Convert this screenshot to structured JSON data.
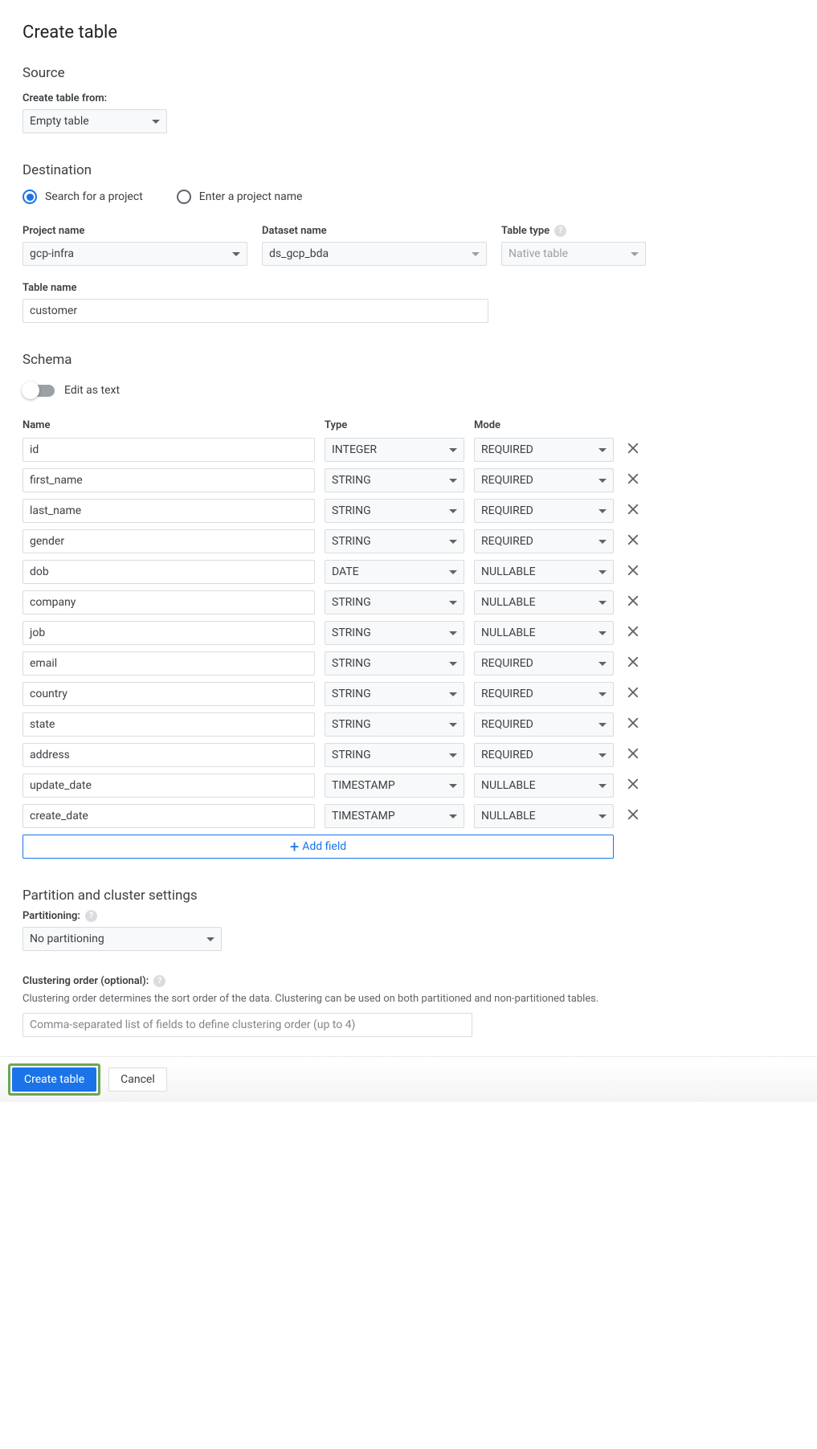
{
  "page_title": "Create table",
  "source": {
    "section_title": "Source",
    "create_from_label": "Create table from:",
    "create_from_value": "Empty table"
  },
  "destination": {
    "section_title": "Destination",
    "radio_search": "Search for a project",
    "radio_enter": "Enter a project name",
    "project_label": "Project name",
    "project_value": "gcp-infra",
    "dataset_label": "Dataset name",
    "dataset_value": "ds_gcp_bda",
    "tabletype_label": "Table type",
    "tabletype_value": "Native table",
    "tablename_label": "Table name",
    "tablename_value": "customer"
  },
  "schema": {
    "section_title": "Schema",
    "edit_as_text": "Edit as text",
    "header_name": "Name",
    "header_type": "Type",
    "header_mode": "Mode",
    "add_field": "Add field",
    "rows": [
      {
        "name": "id",
        "type": "INTEGER",
        "mode": "REQUIRED"
      },
      {
        "name": "first_name",
        "type": "STRING",
        "mode": "REQUIRED"
      },
      {
        "name": "last_name",
        "type": "STRING",
        "mode": "REQUIRED"
      },
      {
        "name": "gender",
        "type": "STRING",
        "mode": "REQUIRED"
      },
      {
        "name": "dob",
        "type": "DATE",
        "mode": "NULLABLE"
      },
      {
        "name": "company",
        "type": "STRING",
        "mode": "NULLABLE"
      },
      {
        "name": "job",
        "type": "STRING",
        "mode": "NULLABLE"
      },
      {
        "name": "email",
        "type": "STRING",
        "mode": "REQUIRED"
      },
      {
        "name": "country",
        "type": "STRING",
        "mode": "REQUIRED"
      },
      {
        "name": "state",
        "type": "STRING",
        "mode": "REQUIRED"
      },
      {
        "name": "address",
        "type": "STRING",
        "mode": "REQUIRED"
      },
      {
        "name": "update_date",
        "type": "TIMESTAMP",
        "mode": "NULLABLE"
      },
      {
        "name": "create_date",
        "type": "TIMESTAMP",
        "mode": "NULLABLE"
      }
    ]
  },
  "partition": {
    "section_title": "Partition and cluster settings",
    "partitioning_label": "Partitioning:",
    "partitioning_value": "No partitioning",
    "clustering_label": "Clustering order (optional):",
    "clustering_desc": "Clustering order determines the sort order of the data. Clustering can be used on both partitioned and non-partitioned tables.",
    "clustering_placeholder": "Comma-separated list of fields to define clustering order (up to 4)"
  },
  "footer": {
    "create": "Create table",
    "cancel": "Cancel"
  }
}
